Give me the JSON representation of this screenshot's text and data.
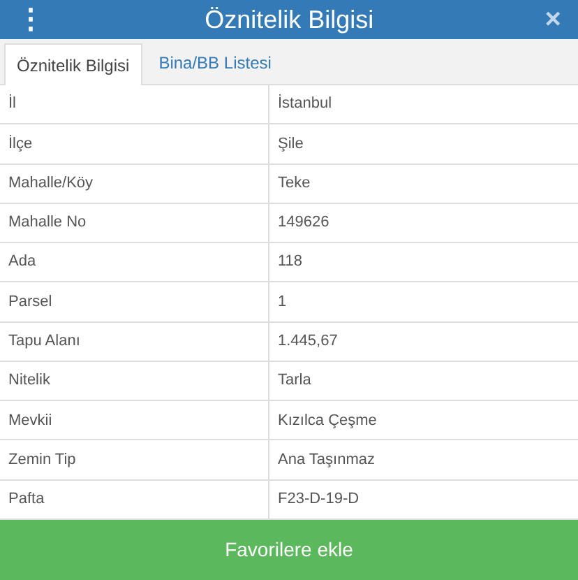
{
  "header": {
    "menu_icon": "⋮",
    "title": "Öznitelik Bilgisi",
    "close_icon": "×"
  },
  "tabs": [
    {
      "label": "Öznitelik Bilgisi",
      "selected": true
    },
    {
      "label": "Bina/BB Listesi",
      "selected": false
    }
  ],
  "rows": [
    {
      "label": "İl",
      "value": "İstanbul"
    },
    {
      "label": "İlçe",
      "value": "Şile"
    },
    {
      "label": "Mahalle/Köy",
      "value": "Teke"
    },
    {
      "label": "Mahalle No",
      "value": "149626"
    },
    {
      "label": "Ada",
      "value": "118"
    },
    {
      "label": "Parsel",
      "value": "1"
    },
    {
      "label": "Tapu Alanı",
      "value": "1.445,67"
    },
    {
      "label": "Nitelik",
      "value": "Tarla"
    },
    {
      "label": "Mevkii",
      "value": "Kızılca Çeşme"
    },
    {
      "label": "Zemin Tip",
      "value": "Ana Taşınmaz"
    },
    {
      "label": "Pafta",
      "value": "F23-D-19-D"
    }
  ],
  "button": "Favorilere ekle"
}
